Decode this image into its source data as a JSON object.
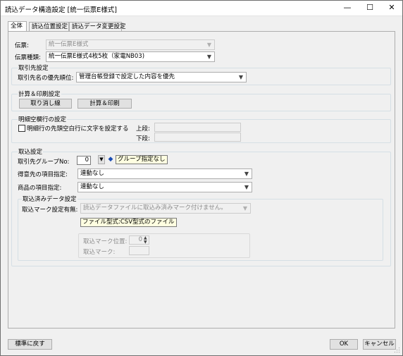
{
  "window": {
    "title": "読込データ構造設定 [統一伝票E様式]",
    "minimize": "—",
    "maximize": "☐",
    "close": "✕"
  },
  "tabs": [
    {
      "label": "全体",
      "active": true
    },
    {
      "label": "読込位置設定",
      "active": false
    },
    {
      "label": "読込データ変更設定",
      "active": false
    }
  ],
  "slip": {
    "label": "伝票:",
    "value": "統一伝票E様式",
    "type_label": "伝票種類:",
    "type_value": "統一伝票E様式4枚5枚（家電NB03)"
  },
  "customer": {
    "title": "取引先設定",
    "priority_label": "取引先名の優先順位:",
    "priority_value": "管理台帳登録で設定した内容を優先"
  },
  "calc": {
    "title": "計算＆印刷設定",
    "cancel_line_button": "取り消し線",
    "calc_print_button": "計算＆印刷"
  },
  "blank_row": {
    "title": "明細空欄行の設定",
    "checkbox_label": "明細行の先頭空白行に文字を設定する",
    "upper_label": "上段:",
    "lower_label": "下段:"
  },
  "import": {
    "title": "取込設定",
    "group_no_label": "取引先グループNo:",
    "group_no_value": "0",
    "group_tip": "グループ指定なし",
    "destination_label": "得意先の項目指定:",
    "destination_value": "連動なし",
    "product_label": "商品の項目指定:",
    "product_value": "連動なし",
    "done": {
      "title": "取込済みデータ設定",
      "mark_label": "取込マーク設定有無:",
      "mark_value": "読込データファイルに取込み済みマーク付けません。",
      "file_tip": "ファイル型式:CSV型式のファイル",
      "position_label": "取込マーク位置:",
      "position_value": "0",
      "mark_char_label": "取込マーク:"
    }
  },
  "footer": {
    "reset_button": "標準に戻す",
    "ok_button": "OK",
    "cancel_button": "キャンセル"
  }
}
